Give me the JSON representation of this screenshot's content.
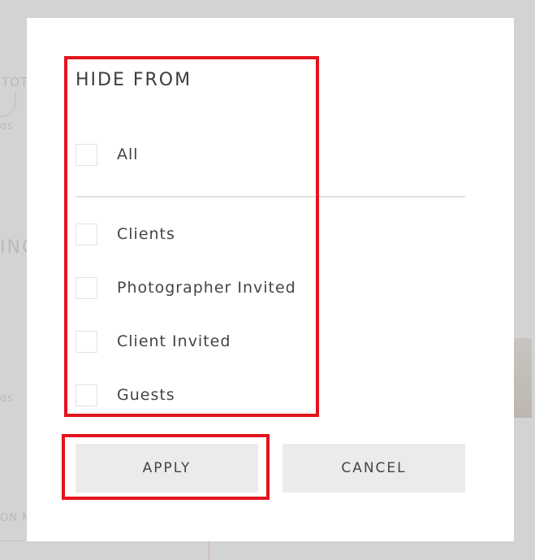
{
  "background": {
    "fragments": [
      "TOT",
      "os",
      "ING",
      "os",
      "ON M",
      "Photographer Invited"
    ]
  },
  "dialog": {
    "title": "HIDE FROM",
    "options": [
      {
        "label": "All",
        "checked": false
      },
      {
        "label": "Clients",
        "checked": false
      },
      {
        "label": "Photographer Invited",
        "checked": false
      },
      {
        "label": "Client Invited",
        "checked": false
      },
      {
        "label": "Guests",
        "checked": false
      }
    ],
    "buttons": {
      "apply": "APPLY",
      "cancel": "CANCEL"
    }
  },
  "colors": {
    "highlight": "#e3141e",
    "button_bg": "#ebebeb",
    "text": "#444444",
    "overlay": "#d3d3d3"
  }
}
